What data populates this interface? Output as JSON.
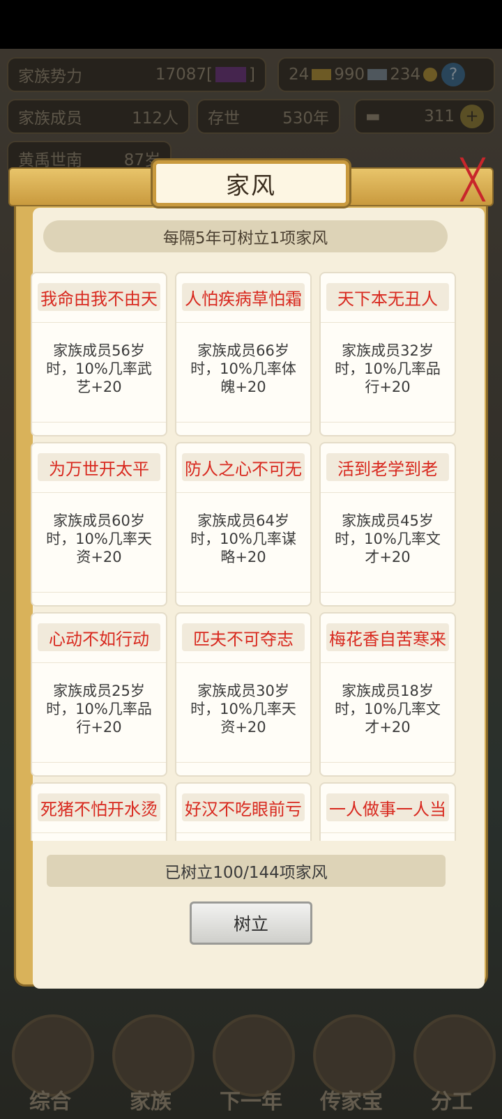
{
  "background": {
    "clan_power_label": "家族势力",
    "clan_power_value": "17087[",
    "clan_power_suffix": "]",
    "res1": "24",
    "res2": "990",
    "res3": "234",
    "members_label": "家族成员",
    "members_value": "112人",
    "existence_label": "存世",
    "existence_value": "530年",
    "gold_value": "311",
    "patriarch_name": "黄禹世南",
    "patriarch_age": "87岁",
    "nav": [
      {
        "label": "综合"
      },
      {
        "label": "家族"
      },
      {
        "label": "下一年"
      },
      {
        "label": "传家宝"
      },
      {
        "label": "分工"
      }
    ]
  },
  "dialog": {
    "title": "家风",
    "close_symbol": "╳",
    "hint": "每隔5年可树立1项家风",
    "count_text": "已树立100/144项家风",
    "establish_label": "树立"
  },
  "mottos": [
    {
      "name": "我命由我不由天",
      "desc": "家族成员56岁时，10%几率武艺+20"
    },
    {
      "name": "人怕疾病草怕霜",
      "desc": "家族成员66岁时，10%几率体魄+20"
    },
    {
      "name": "天下本无丑人",
      "desc": "家族成员32岁时，10%几率品行+20"
    },
    {
      "name": "为万世开太平",
      "desc": "家族成员60岁时，10%几率天资+20"
    },
    {
      "name": "防人之心不可无",
      "desc": "家族成员64岁时，10%几率谋略+20"
    },
    {
      "name": "活到老学到老",
      "desc": "家族成员45岁时，10%几率文才+20"
    },
    {
      "name": "心动不如行动",
      "desc": "家族成员25岁时，10%几率品行+20"
    },
    {
      "name": "匹夫不可夺志",
      "desc": "家族成员30岁时，10%几率天资+20"
    },
    {
      "name": "梅花香自苦寒来",
      "desc": "家族成员18岁时，10%几率文才+20"
    },
    {
      "name": "死猪不怕开水烫",
      "desc": ""
    },
    {
      "name": "好汉不吃眼前亏",
      "desc": ""
    },
    {
      "name": "一人做事一人当",
      "desc": ""
    }
  ],
  "colors": {
    "motto_red": "#d8281e",
    "frame_gold": "#d9b25a",
    "panel_cream": "#f6efdc"
  }
}
